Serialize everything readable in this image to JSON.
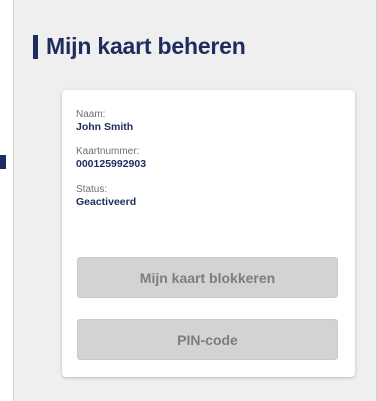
{
  "header": {
    "title": "Mijn kaart beheren"
  },
  "card": {
    "name": {
      "label": "Naam:",
      "value": "John Smith"
    },
    "card_number": {
      "label": "Kaartnummer:",
      "value": "000125992903"
    },
    "status": {
      "label": "Status:",
      "value": "Geactiveerd"
    }
  },
  "buttons": {
    "block_card": "Mijn kaart blokkeren",
    "pin_code": "PIN-code"
  },
  "colors": {
    "brand": "#1c2d5e",
    "panel_bg": "#efefef",
    "button_bg": "#d3d3d3",
    "button_text": "#7d7d7d"
  }
}
